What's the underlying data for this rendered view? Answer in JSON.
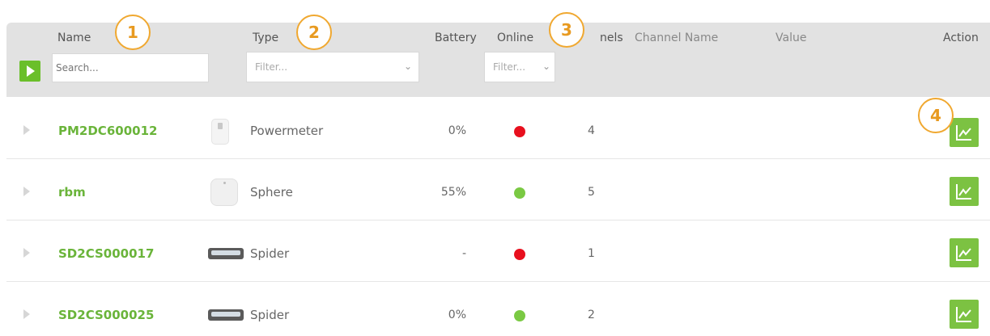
{
  "table": {
    "columns": {
      "name": "Name",
      "type": "Type",
      "battery": "Battery",
      "online": "Online",
      "channels": "nels",
      "channel_name": "Channel Name",
      "value": "Value",
      "actions": "Action"
    },
    "filters": {
      "name_placeholder": "Search...",
      "type_placeholder": "Filter...",
      "online_placeholder": "Filter..."
    },
    "rows": [
      {
        "name": "PM2DC600012",
        "type": "Powermeter",
        "battery": "0%",
        "online": false,
        "channels": "4",
        "icon": "powermeter-icon"
      },
      {
        "name": "rbm",
        "type": "Sphere",
        "battery": "55%",
        "online": true,
        "channels": "5",
        "icon": "sphere-icon"
      },
      {
        "name": "SD2CS000017",
        "type": "Spider",
        "battery": "-",
        "online": false,
        "channels": "1",
        "icon": "spider-icon"
      },
      {
        "name": "SD2CS000025",
        "type": "Spider",
        "battery": "0%",
        "online": true,
        "channels": "2",
        "icon": "spider-icon"
      }
    ]
  },
  "callouts": [
    "1",
    "2",
    "3",
    "4"
  ],
  "colors": {
    "accent": "#7cc242",
    "name_link": "#6ab43a",
    "online": "#7ac943",
    "offline": "#e8101e",
    "callout": "#f0a830",
    "header_bg": "#e2e2e2"
  }
}
